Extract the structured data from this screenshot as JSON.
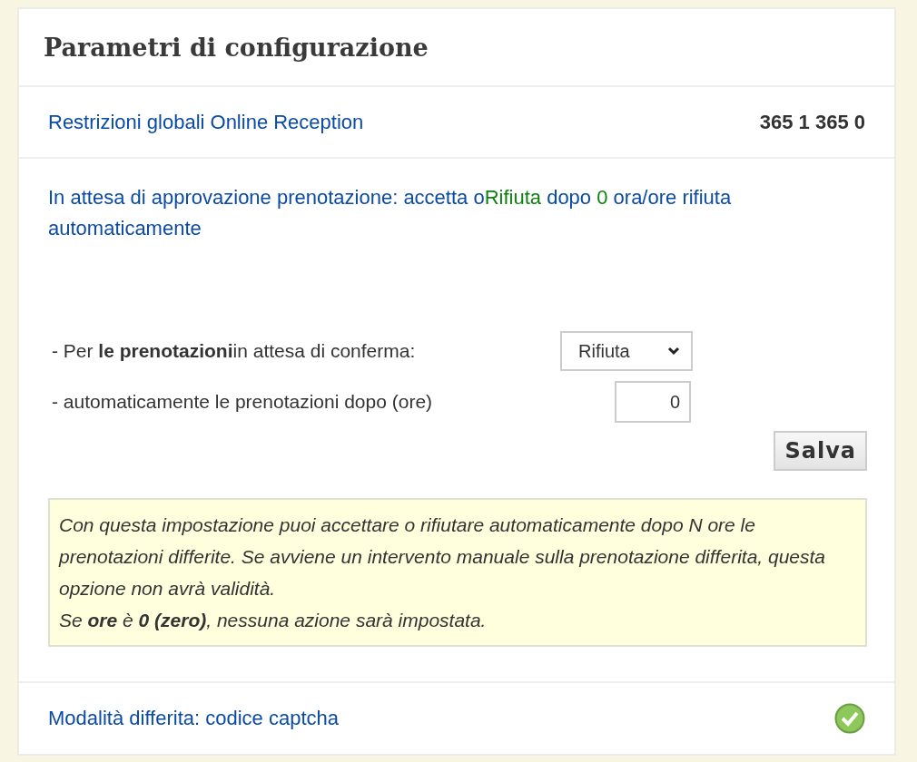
{
  "panel": {
    "title": "Parametri di configurazione"
  },
  "restrictions": {
    "label": "Restrizioni globali Online Reception",
    "value": "365 1 365 0"
  },
  "pending": {
    "heading": [
      {
        "text": "In attesa di approvazione prenotazione: accetta o",
        "highlight": false
      },
      {
        "text": "Rifiuta",
        "highlight": true
      },
      {
        "text": " dopo ",
        "highlight": false
      },
      {
        "text": "0",
        "highlight": true
      },
      {
        "text": " ora/ore rifiuta automaticamente",
        "highlight": false
      }
    ],
    "action_label": "- Per **le prenotazioni**in attesa di conferma:",
    "action_value": "Rifiuta",
    "hours_label": "- automaticamente le prenotazioni dopo (ore)",
    "hours_value": "0",
    "save_button": "Salva",
    "hint": [
      "Con questa impostazione puoi accettare o rifiutare automaticamente dopo N ore le prenotazioni differite. Se avviene un intervento manuale sulla prenotazione differita, questa opzione non avrà validità.",
      "Se **ore** è **0 (zero)**, nessuna azione sarà impostata."
    ]
  },
  "captcha": {
    "label": "Modalità differita: codice captcha",
    "enabled": true
  }
}
